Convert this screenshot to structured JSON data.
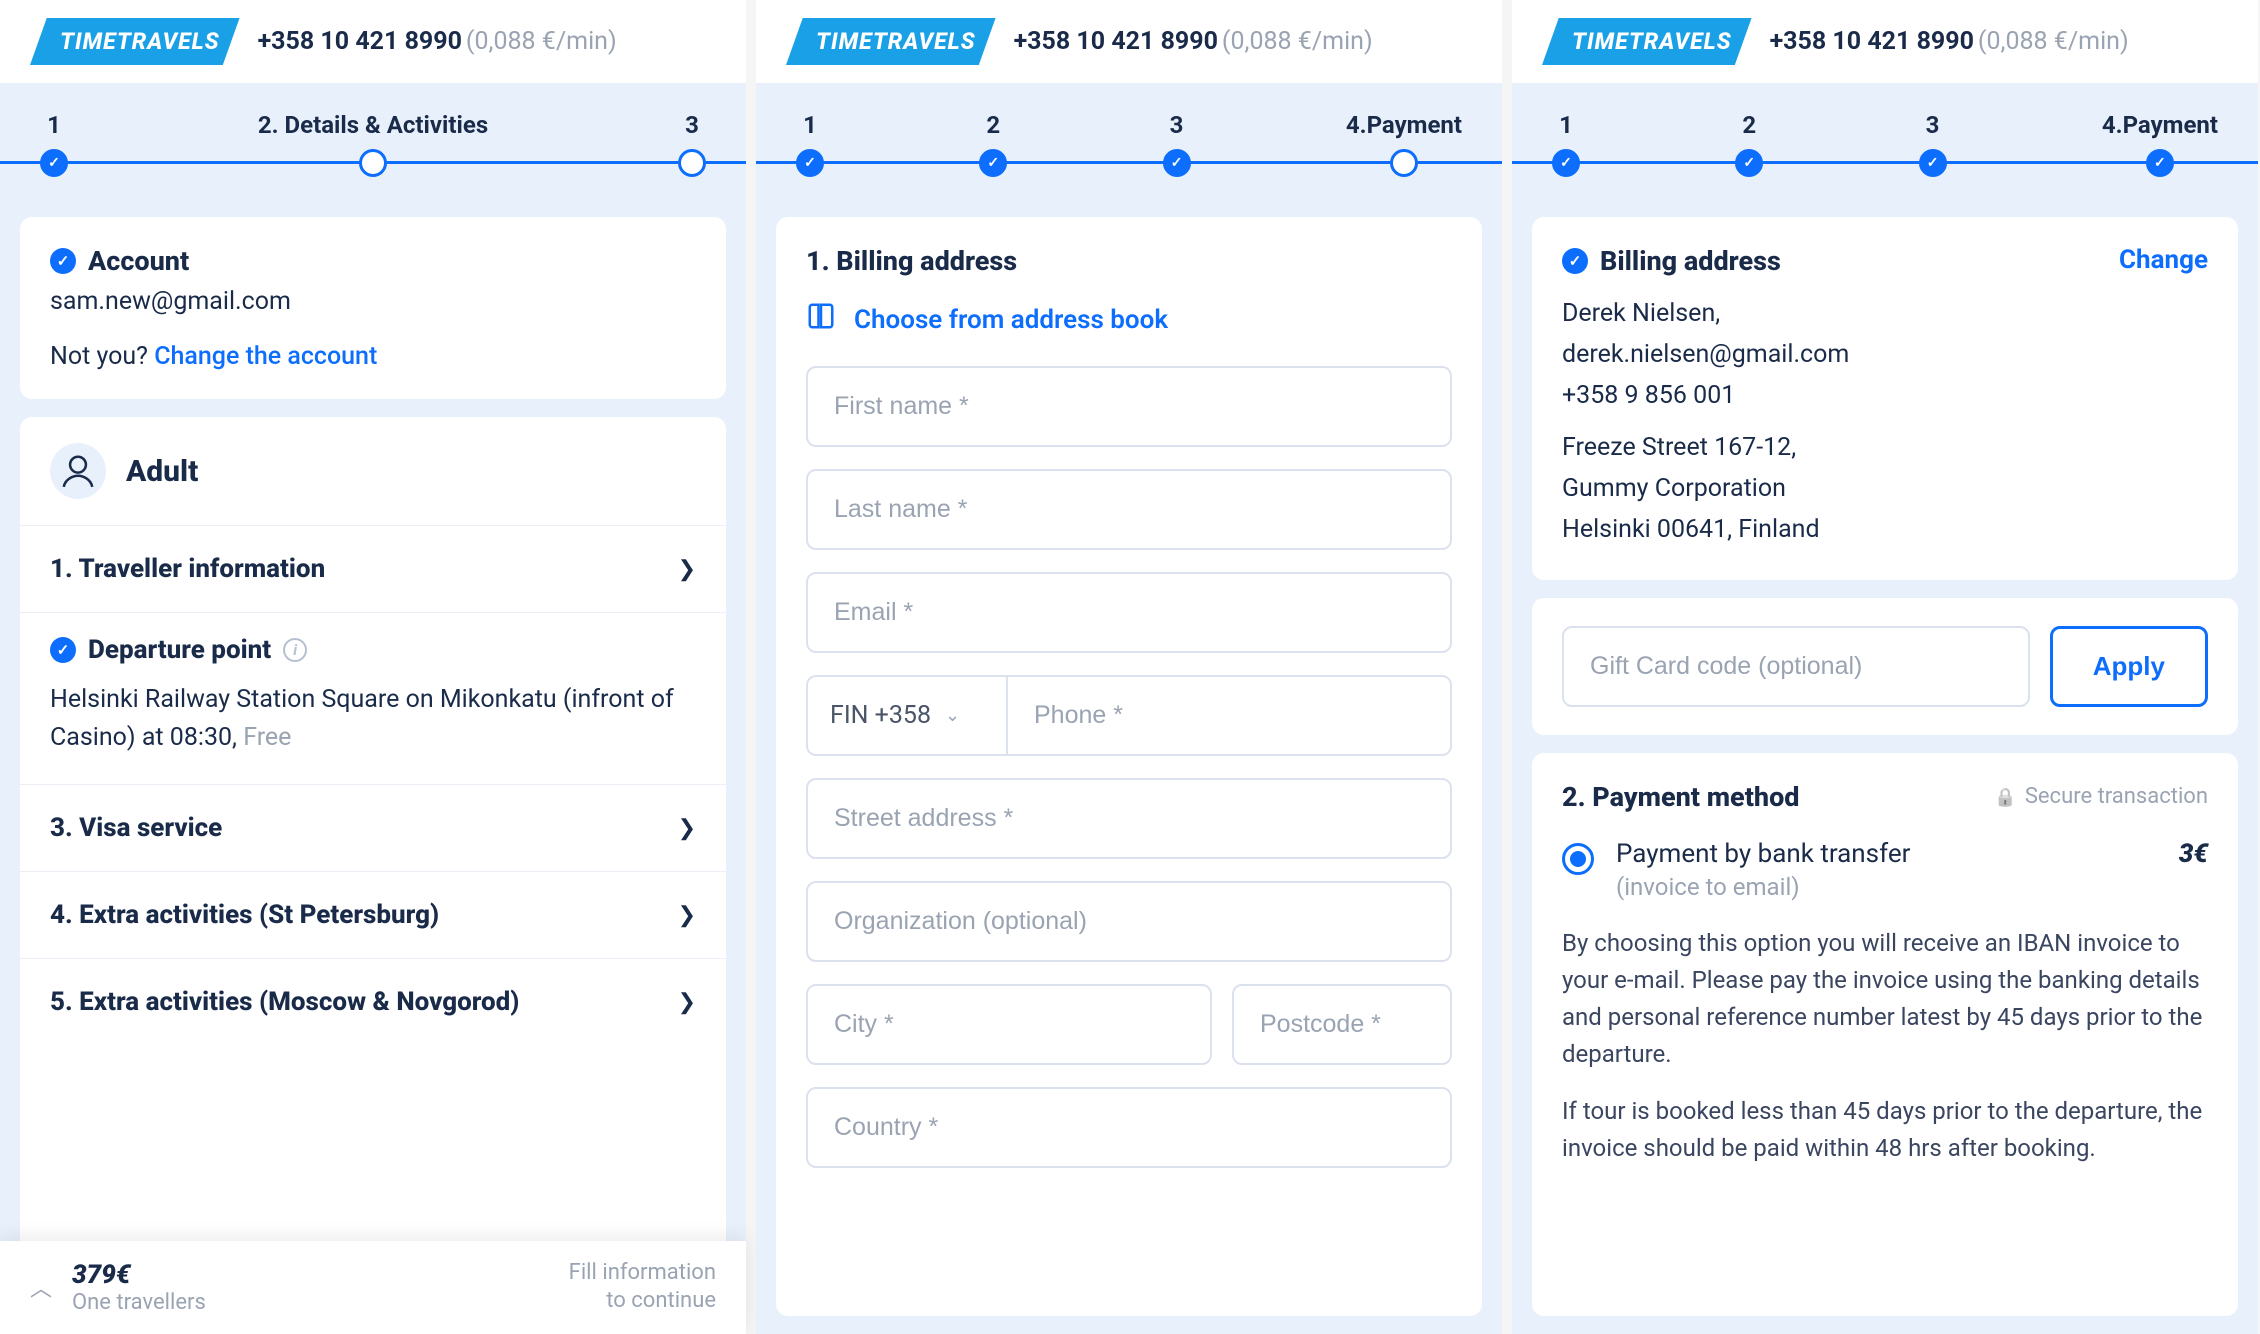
{
  "brand": "TIMETRAVELS",
  "phone": "+358 10 421 8990",
  "rate": "(0,088 €/min)",
  "screen1": {
    "steps": [
      {
        "label": "1",
        "done": true
      },
      {
        "label": "2. Details & Activities",
        "done": false
      },
      {
        "label": "3",
        "done": false
      }
    ],
    "account": {
      "title": "Account",
      "email": "sam.new@gmail.com",
      "notyou_prefix": "Not you? ",
      "change": "Change the account"
    },
    "adult": {
      "title": "Adult",
      "rows": {
        "traveller": "1. Traveller information",
        "departure_title": "Departure point",
        "departure_text": "Helsinki Railway Station Square on Mikonkatu (infront of Casino) at 08:30, ",
        "free": "Free",
        "visa": "3. Visa service",
        "extra_spb": "4. Extra activities (St Petersburg)",
        "extra_mn": "5. Extra activities (Moscow & Novgorod)"
      }
    },
    "footer": {
      "price": "379€",
      "travellers": "One travellers",
      "msg_l1": "Fill information",
      "msg_l2": "to continue"
    }
  },
  "screen2": {
    "steps": [
      {
        "label": "1",
        "done": true
      },
      {
        "label": "2",
        "done": true
      },
      {
        "label": "3",
        "done": true
      },
      {
        "label": "4.Payment",
        "done": false
      }
    ],
    "billing_title": "1. Billing address",
    "address_book": "Choose from address book",
    "placeholders": {
      "first": "First name *",
      "last": "Last name *",
      "email": "Email *",
      "prefix": "FIN +358",
      "phone": "Phone *",
      "street": "Street address *",
      "org": "Organization (optional)",
      "city": "City *",
      "postcode": "Postcode *",
      "country": "Country *"
    }
  },
  "screen3": {
    "steps": [
      {
        "label": "1",
        "done": true
      },
      {
        "label": "2",
        "done": true
      },
      {
        "label": "3",
        "done": true
      },
      {
        "label": "4.Payment",
        "done": true
      }
    ],
    "billing": {
      "title": "Billing address",
      "change": "Change",
      "name": "Derek Nielsen,",
      "email": "derek.nielsen@gmail.com",
      "phone": "+358 9 856 001",
      "street": "Freeze Street  167-12,",
      "org": "Gummy Corporation",
      "city": "Helsinki 00641, Finland"
    },
    "gift": {
      "placeholder": "Gift Card code (optional)",
      "apply": "Apply"
    },
    "payment": {
      "title": "2. Payment method",
      "secure": "Secure transaction",
      "option_label": "Payment by bank transfer",
      "option_sub": "(invoice to email)",
      "fee": "3€",
      "desc1": "By choosing this option you will receive an IBAN invoice to your e-mail. Please pay the invoice using the banking details and personal reference number latest by 45 days prior to the departure.",
      "desc2": "If tour is booked less than 45 days prior to the departure, the invoice should be paid within 48 hrs after booking."
    }
  }
}
